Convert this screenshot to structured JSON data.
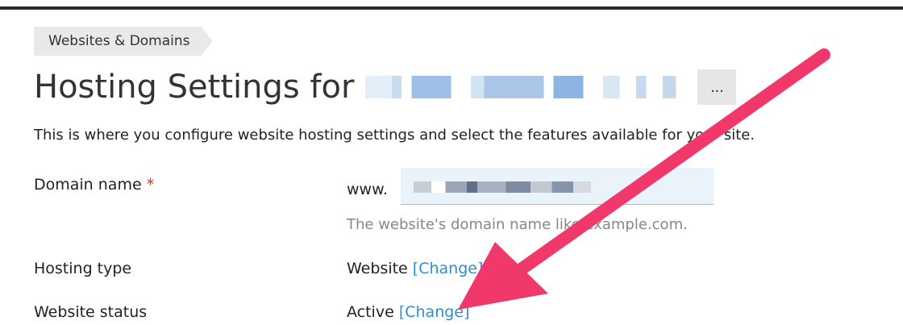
{
  "breadcrumb": "Websites & Domains",
  "page_title": "Hosting Settings for",
  "more_button": "...",
  "description": "This is where you configure website hosting settings and select the features available for your site.",
  "fields": {
    "domain": {
      "label": "Domain name",
      "required_mark": "*",
      "prefix": "www.",
      "hint": "The website's domain name like example.com."
    },
    "hosting_type": {
      "label": "Hosting type",
      "value": "Website",
      "change_link": "[Change]"
    },
    "website_status": {
      "label": "Website status",
      "value": "Active",
      "change_link": "[Change]"
    }
  },
  "colors": {
    "link": "#2b8fd8",
    "annotation_arrow": "#f0386b",
    "required": "#c0392b"
  }
}
